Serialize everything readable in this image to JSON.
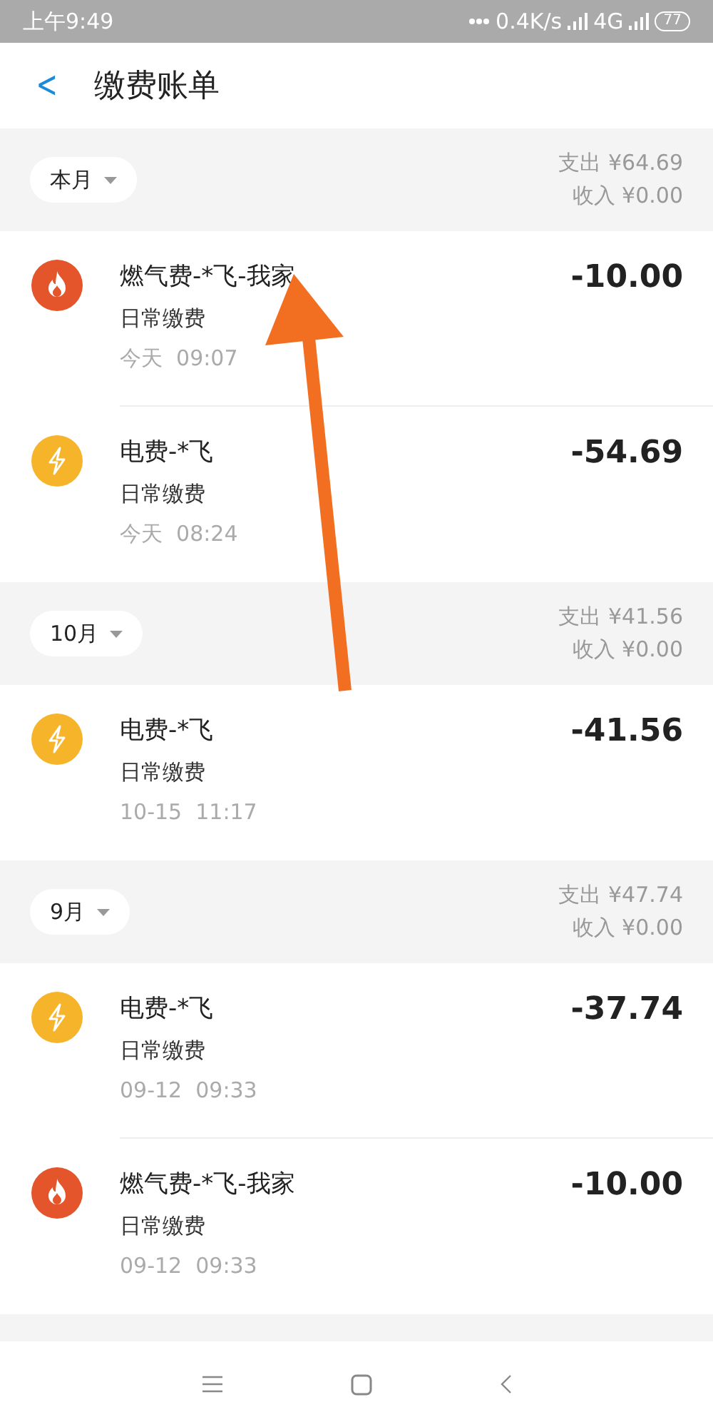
{
  "status_bar": {
    "time": "上午9:49",
    "speed": "0.4K/s",
    "network": "4G",
    "battery": "77"
  },
  "header": {
    "back": "<",
    "title": "缴费账单"
  },
  "groups": [
    {
      "period": "本月",
      "expense": "支出 ¥64.69",
      "income": "收入 ¥0.00",
      "items": [
        {
          "kind": "gas",
          "title": "燃气费-*飞-我家",
          "category": "日常缴费",
          "time": "今天  09:07",
          "amount": "-10.00"
        },
        {
          "kind": "electric",
          "title": "电费-*飞",
          "category": "日常缴费",
          "time": "今天  08:24",
          "amount": "-54.69"
        }
      ]
    },
    {
      "period": "10月",
      "expense": "支出 ¥41.56",
      "income": "收入 ¥0.00",
      "items": [
        {
          "kind": "electric",
          "title": "电费-*飞",
          "category": "日常缴费",
          "time": "10-15  11:17",
          "amount": "-41.56"
        }
      ]
    },
    {
      "period": "9月",
      "expense": "支出 ¥47.74",
      "income": "收入 ¥0.00",
      "items": [
        {
          "kind": "electric",
          "title": "电费-*飞",
          "category": "日常缴费",
          "time": "09-12  09:33",
          "amount": "-37.74"
        },
        {
          "kind": "gas",
          "title": "燃气费-*飞-我家",
          "category": "日常缴费",
          "time": "09-12  09:33",
          "amount": "-10.00"
        }
      ]
    }
  ]
}
